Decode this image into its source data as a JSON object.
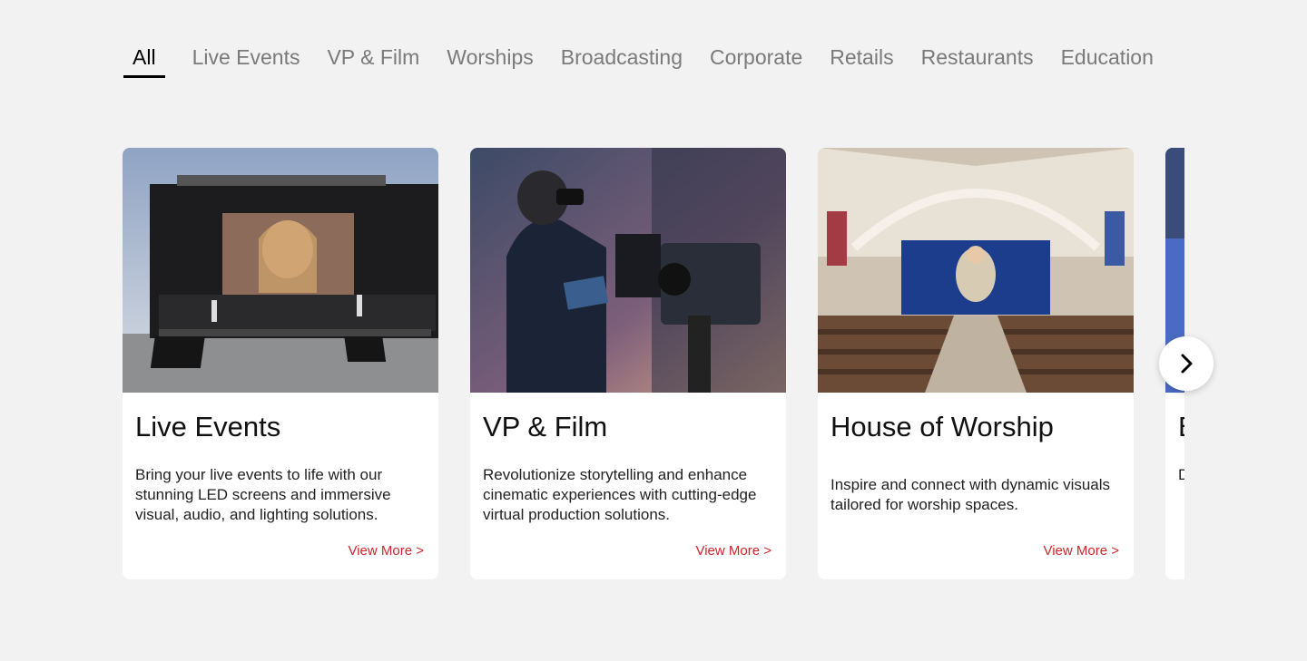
{
  "tabs": [
    {
      "label": "All",
      "active": true
    },
    {
      "label": "Live Events"
    },
    {
      "label": "VP & Film"
    },
    {
      "label": "Worships"
    },
    {
      "label": "Broadcasting"
    },
    {
      "label": "Corporate"
    },
    {
      "label": "Retails"
    },
    {
      "label": "Restaurants"
    },
    {
      "label": "Education"
    }
  ],
  "cards": [
    {
      "title": "Live Events",
      "description": "Bring your live events to life with our stunning LED screens and immersive visual, audio, and lighting solutions.",
      "link": "View More >"
    },
    {
      "title": "VP & Film",
      "description": "Revolutionize storytelling and enhance cinematic experiences  with cutting-edge virtual production solutions.",
      "link": "View More >"
    },
    {
      "title": "House of Worship",
      "description": "Inspire and connect with dynamic visuals tailored for worship spaces.",
      "link": "View More >"
    },
    {
      "title": "B",
      "description": "D c",
      "link": ""
    }
  ],
  "colors": {
    "accent": "#d1262b",
    "active_tab": "#000000",
    "inactive_tab": "#7a7a7a",
    "background": "#f2f2f2"
  },
  "icons": {
    "next": "chevron-right-icon"
  }
}
